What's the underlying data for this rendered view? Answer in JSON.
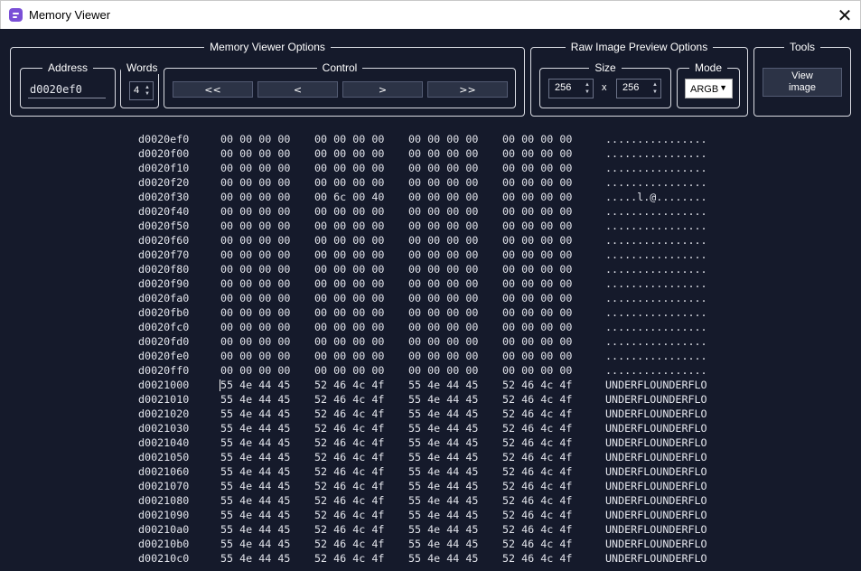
{
  "window": {
    "title": "Memory Viewer",
    "close_glyph": "✕"
  },
  "options": {
    "group_title": "Memory Viewer Options",
    "address": {
      "label": "Address",
      "value": "d0020ef0"
    },
    "words": {
      "label": "Words",
      "value": "4"
    },
    "control": {
      "label": "Control",
      "buttons": [
        "<<",
        "<",
        ">",
        ">>"
      ]
    }
  },
  "raw_preview": {
    "group_title": "Raw Image Preview Options",
    "size": {
      "label": "Size",
      "width": "256",
      "separator": "x",
      "height": "256"
    },
    "mode": {
      "label": "Mode",
      "value": "ARGB"
    }
  },
  "tools": {
    "group_title": "Tools",
    "view_image_label": "View image"
  },
  "dump_rows": [
    {
      "addr": "d0020ef0",
      "words": [
        "00 00 00 00",
        "00 00 00 00",
        "00 00 00 00",
        "00 00 00 00"
      ],
      "ascii": "................"
    },
    {
      "addr": "d0020f00",
      "words": [
        "00 00 00 00",
        "00 00 00 00",
        "00 00 00 00",
        "00 00 00 00"
      ],
      "ascii": "................"
    },
    {
      "addr": "d0020f10",
      "words": [
        "00 00 00 00",
        "00 00 00 00",
        "00 00 00 00",
        "00 00 00 00"
      ],
      "ascii": "................"
    },
    {
      "addr": "d0020f20",
      "words": [
        "00 00 00 00",
        "00 00 00 00",
        "00 00 00 00",
        "00 00 00 00"
      ],
      "ascii": "................"
    },
    {
      "addr": "d0020f30",
      "words": [
        "00 00 00 00",
        "00 6c 00 40",
        "00 00 00 00",
        "00 00 00 00"
      ],
      "ascii": ".....l.@........"
    },
    {
      "addr": "d0020f40",
      "words": [
        "00 00 00 00",
        "00 00 00 00",
        "00 00 00 00",
        "00 00 00 00"
      ],
      "ascii": "................"
    },
    {
      "addr": "d0020f50",
      "words": [
        "00 00 00 00",
        "00 00 00 00",
        "00 00 00 00",
        "00 00 00 00"
      ],
      "ascii": "................"
    },
    {
      "addr": "d0020f60",
      "words": [
        "00 00 00 00",
        "00 00 00 00",
        "00 00 00 00",
        "00 00 00 00"
      ],
      "ascii": "................"
    },
    {
      "addr": "d0020f70",
      "words": [
        "00 00 00 00",
        "00 00 00 00",
        "00 00 00 00",
        "00 00 00 00"
      ],
      "ascii": "................"
    },
    {
      "addr": "d0020f80",
      "words": [
        "00 00 00 00",
        "00 00 00 00",
        "00 00 00 00",
        "00 00 00 00"
      ],
      "ascii": "................"
    },
    {
      "addr": "d0020f90",
      "words": [
        "00 00 00 00",
        "00 00 00 00",
        "00 00 00 00",
        "00 00 00 00"
      ],
      "ascii": "................"
    },
    {
      "addr": "d0020fa0",
      "words": [
        "00 00 00 00",
        "00 00 00 00",
        "00 00 00 00",
        "00 00 00 00"
      ],
      "ascii": "................"
    },
    {
      "addr": "d0020fb0",
      "words": [
        "00 00 00 00",
        "00 00 00 00",
        "00 00 00 00",
        "00 00 00 00"
      ],
      "ascii": "................"
    },
    {
      "addr": "d0020fc0",
      "words": [
        "00 00 00 00",
        "00 00 00 00",
        "00 00 00 00",
        "00 00 00 00"
      ],
      "ascii": "................"
    },
    {
      "addr": "d0020fd0",
      "words": [
        "00 00 00 00",
        "00 00 00 00",
        "00 00 00 00",
        "00 00 00 00"
      ],
      "ascii": "................"
    },
    {
      "addr": "d0020fe0",
      "words": [
        "00 00 00 00",
        "00 00 00 00",
        "00 00 00 00",
        "00 00 00 00"
      ],
      "ascii": "................"
    },
    {
      "addr": "d0020ff0",
      "words": [
        "00 00 00 00",
        "00 00 00 00",
        "00 00 00 00",
        "00 00 00 00"
      ],
      "ascii": "................"
    },
    {
      "addr": "d0021000",
      "words": [
        "55 4e 44 45",
        "52 46 4c 4f",
        "55 4e 44 45",
        "52 46 4c 4f"
      ],
      "ascii": "UNDERFLOUNDERFLO"
    },
    {
      "addr": "d0021010",
      "words": [
        "55 4e 44 45",
        "52 46 4c 4f",
        "55 4e 44 45",
        "52 46 4c 4f"
      ],
      "ascii": "UNDERFLOUNDERFLO"
    },
    {
      "addr": "d0021020",
      "words": [
        "55 4e 44 45",
        "52 46 4c 4f",
        "55 4e 44 45",
        "52 46 4c 4f"
      ],
      "ascii": "UNDERFLOUNDERFLO"
    },
    {
      "addr": "d0021030",
      "words": [
        "55 4e 44 45",
        "52 46 4c 4f",
        "55 4e 44 45",
        "52 46 4c 4f"
      ],
      "ascii": "UNDERFLOUNDERFLO"
    },
    {
      "addr": "d0021040",
      "words": [
        "55 4e 44 45",
        "52 46 4c 4f",
        "55 4e 44 45",
        "52 46 4c 4f"
      ],
      "ascii": "UNDERFLOUNDERFLO"
    },
    {
      "addr": "d0021050",
      "words": [
        "55 4e 44 45",
        "52 46 4c 4f",
        "55 4e 44 45",
        "52 46 4c 4f"
      ],
      "ascii": "UNDERFLOUNDERFLO"
    },
    {
      "addr": "d0021060",
      "words": [
        "55 4e 44 45",
        "52 46 4c 4f",
        "55 4e 44 45",
        "52 46 4c 4f"
      ],
      "ascii": "UNDERFLOUNDERFLO"
    },
    {
      "addr": "d0021070",
      "words": [
        "55 4e 44 45",
        "52 46 4c 4f",
        "55 4e 44 45",
        "52 46 4c 4f"
      ],
      "ascii": "UNDERFLOUNDERFLO"
    },
    {
      "addr": "d0021080",
      "words": [
        "55 4e 44 45",
        "52 46 4c 4f",
        "55 4e 44 45",
        "52 46 4c 4f"
      ],
      "ascii": "UNDERFLOUNDERFLO"
    },
    {
      "addr": "d0021090",
      "words": [
        "55 4e 44 45",
        "52 46 4c 4f",
        "55 4e 44 45",
        "52 46 4c 4f"
      ],
      "ascii": "UNDERFLOUNDERFLO"
    },
    {
      "addr": "d00210a0",
      "words": [
        "55 4e 44 45",
        "52 46 4c 4f",
        "55 4e 44 45",
        "52 46 4c 4f"
      ],
      "ascii": "UNDERFLOUNDERFLO"
    },
    {
      "addr": "d00210b0",
      "words": [
        "55 4e 44 45",
        "52 46 4c 4f",
        "55 4e 44 45",
        "52 46 4c 4f"
      ],
      "ascii": "UNDERFLOUNDERFLO"
    },
    {
      "addr": "d00210c0",
      "words": [
        "55 4e 44 45",
        "52 46 4c 4f",
        "55 4e 44 45",
        "52 46 4c 4f"
      ],
      "ascii": "UNDERFLOUNDERFLO"
    }
  ]
}
